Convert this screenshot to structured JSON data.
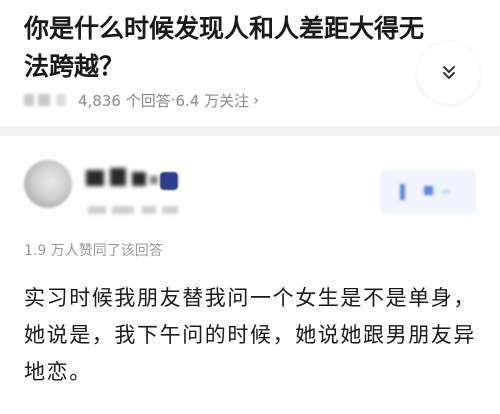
{
  "question": {
    "title": "你是什么时候发现人和人差距大得无法跨越？",
    "answer_count_text": "4,836 个回答",
    "separator": " · ",
    "follower_count_text": "6.4 万关注",
    "chevron_glyph": "›",
    "collapse_icon": "chevron-double-down-icon"
  },
  "answer": {
    "vote_summary": "1.9 万人赞同了该回答",
    "content": "实习时候我朋友替我问一个女生是不是单身，她说是，我下午问的时候，她说她跟男朋友异地恋。"
  },
  "colors": {
    "title": "#1a1a1a",
    "meta": "#8a8a8a",
    "divider": "#f4f4f4",
    "follow_accent": "#5a86e8"
  }
}
